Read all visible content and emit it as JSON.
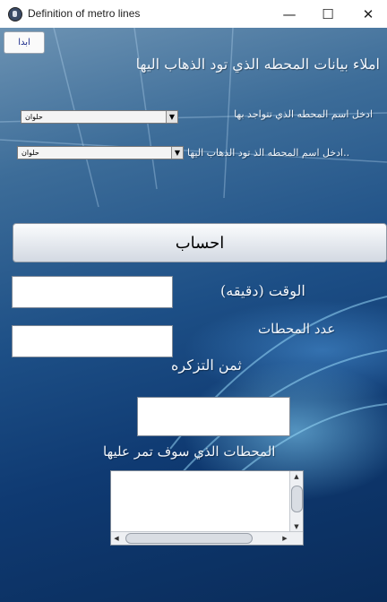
{
  "window": {
    "title": "Definition of metro lines",
    "app_icon": "java-cup-icon",
    "minimize_glyph": "—",
    "maximize_glyph": "☐",
    "close_glyph": "✕"
  },
  "toolbar": {
    "start_label": "ابدا"
  },
  "form": {
    "heading": "املاء بيانات المحطه الذي تود الذهاب اليها",
    "current_station_label": "ادخل اسم المحطه الذي تتواجد بها",
    "current_station_value": "حلوان",
    "destination_station_label": "ادخل اسم المحطه الذ تود الذهاب اليها..",
    "destination_station_value": "حلوان",
    "calculate_label": "احساب",
    "time_label": "الوقت (دقيقه)",
    "time_value": "",
    "stations_count_label": "عدد المحطات",
    "stations_count_value": "",
    "ticket_price_label": "ثمن التزكره",
    "ticket_price_value": "",
    "stations_list_label": "المحطات الذي سوف تمر عليها",
    "stations_list": []
  },
  "colors": {
    "background_top": "#6d93b3",
    "background_bottom": "#0a2c5a",
    "label_text": "#f2f6fb",
    "start_text": "#1a2a8a"
  }
}
